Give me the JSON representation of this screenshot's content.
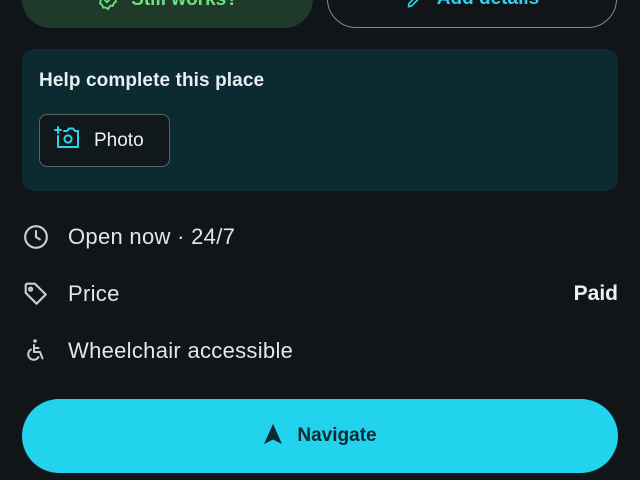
{
  "actions": {
    "still_works_label": "Still works?",
    "add_details_label": "Add details"
  },
  "help_card": {
    "title": "Help complete this place",
    "photo_label": "Photo"
  },
  "info": {
    "hours": "Open now · 24/7",
    "price_label": "Price",
    "price_value": "Paid",
    "accessibility": "Wheelchair accessible"
  },
  "navigate": {
    "label": "Navigate"
  },
  "colors": {
    "background": "#111518",
    "accent": "#22d3ee",
    "success": "#6ee07e",
    "card": "#0c2b31"
  },
  "icons": {
    "still_works": "check-badge-icon",
    "add_details": "pencil-icon",
    "photo": "add-photo-icon",
    "hours": "clock-icon",
    "price": "tag-icon",
    "accessibility": "wheelchair-icon",
    "navigate": "navigation-arrow-icon"
  }
}
